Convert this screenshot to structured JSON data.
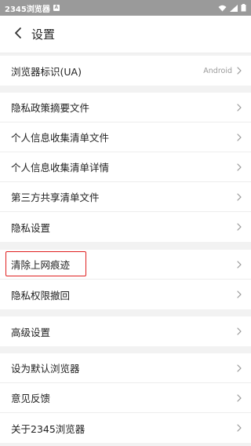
{
  "status_bar": {
    "time": "2345浏览器",
    "badge": "A"
  },
  "header": {
    "title": "设置"
  },
  "sections": [
    {
      "items": [
        {
          "label": "浏览器标识(UA)",
          "value": "Android"
        }
      ]
    },
    {
      "items": [
        {
          "label": "隐私政策摘要文件"
        },
        {
          "label": "个人信息收集清单文件"
        },
        {
          "label": "个人信息收集清单详情"
        },
        {
          "label": "第三方共享清单文件"
        },
        {
          "label": "隐私设置"
        }
      ]
    },
    {
      "items": [
        {
          "label": "清除上网痕迹"
        },
        {
          "label": "隐私权限撤回"
        }
      ]
    },
    {
      "items": [
        {
          "label": "高级设置"
        }
      ]
    },
    {
      "items": [
        {
          "label": "设为默认浏览器"
        },
        {
          "label": "意见反馈"
        },
        {
          "label": "关于2345浏览器"
        }
      ]
    }
  ],
  "colors": {
    "highlight": "#e02020",
    "background": "#f2f2f2"
  }
}
